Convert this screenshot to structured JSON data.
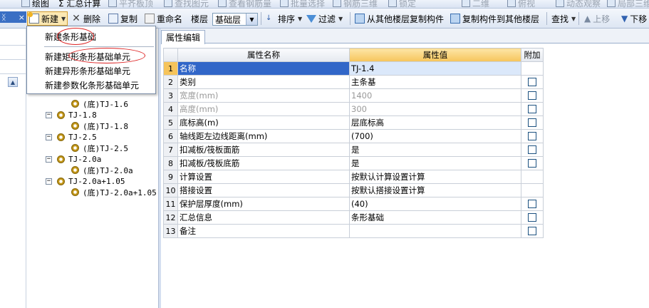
{
  "top_toolbar": {
    "items": [
      "绘图",
      "Σ 汇总计算",
      "平齐板顶",
      "查找图元",
      "查看钢筋量",
      "批量选择",
      "钢筋三维",
      "锁定",
      "二维",
      "俯视",
      "动态观察",
      "局部三维"
    ]
  },
  "toolbar": {
    "new_label": "新建",
    "delete_label": "删除",
    "copy_label": "复制",
    "rename_label": "重命名",
    "floor_label": "楼层",
    "floor_value": "基础层",
    "sort_label": "排序",
    "filter_label": "过滤",
    "copy_from_floor_label": "从其他楼层复制构件",
    "copy_to_floor_label": "复制构件到其他楼层",
    "find_label": "查找",
    "move_up_label": "上移",
    "move_down_label": "下移"
  },
  "left_panel": {
    "header_glyph": "ᛝ",
    "header_close": "×"
  },
  "new_menu": {
    "items": [
      "新建条形基础",
      "新建矩形条形基础单元",
      "新建异形条形基础单元",
      "新建参数化条形基础单元"
    ]
  },
  "tree": {
    "rows": [
      {
        "label": "(底)TJ-1.6",
        "level": 2
      },
      {
        "label": "TJ-1.8",
        "level": 1
      },
      {
        "label": "(底)TJ-1.8",
        "level": 2
      },
      {
        "label": "TJ-2.5",
        "level": 1
      },
      {
        "label": "(底)TJ-2.5",
        "level": 2
      },
      {
        "label": "TJ-2.0a",
        "level": 1
      },
      {
        "label": "(底)TJ-2.0a",
        "level": 2
      },
      {
        "label": "TJ-2.0a+1.05",
        "level": 1
      },
      {
        "label": "(底)TJ-2.0a+1.05",
        "level": 2
      }
    ]
  },
  "properties": {
    "tab_label": "属性编辑",
    "headers": {
      "name": "属性名称",
      "value": "属性值",
      "extra": "附加"
    },
    "rows": [
      {
        "idx": "1",
        "name": "名称",
        "value": "TJ-1.4",
        "gray": false,
        "checkbox": false
      },
      {
        "idx": "2",
        "name": "类别",
        "value": "主条基",
        "gray": false,
        "checkbox": true
      },
      {
        "idx": "3",
        "name": "宽度(mm)",
        "value": "1400",
        "gray": true,
        "checkbox": true
      },
      {
        "idx": "4",
        "name": "高度(mm)",
        "value": "300",
        "gray": true,
        "checkbox": true
      },
      {
        "idx": "5",
        "name": "底标高(m)",
        "value": "层底标高",
        "gray": false,
        "checkbox": true
      },
      {
        "idx": "6",
        "name": "轴线距左边线距离(mm)",
        "value": "(700)",
        "gray": false,
        "checkbox": true
      },
      {
        "idx": "7",
        "name": "扣减板/筏板面筋",
        "value": "是",
        "gray": false,
        "checkbox": true
      },
      {
        "idx": "8",
        "name": "扣减板/筏板底筋",
        "value": "是",
        "gray": false,
        "checkbox": true
      },
      {
        "idx": "9",
        "name": "计算设置",
        "value": "按默认计算设置计算",
        "gray": false,
        "checkbox": false
      },
      {
        "idx": "10",
        "name": "搭接设置",
        "value": "按默认搭接设置计算",
        "gray": false,
        "checkbox": false
      },
      {
        "idx": "11",
        "name": "保护层厚度(mm)",
        "value": "(40)",
        "gray": false,
        "checkbox": true
      },
      {
        "idx": "12",
        "name": "汇总信息",
        "value": "条形基础",
        "gray": false,
        "checkbox": true
      },
      {
        "idx": "13",
        "name": "备注",
        "value": "",
        "gray": false,
        "checkbox": true
      }
    ]
  },
  "colors": {
    "selected_row": "#3166c8",
    "header_highlight": "#f6c45b",
    "annotation_red": "#dd2222"
  }
}
